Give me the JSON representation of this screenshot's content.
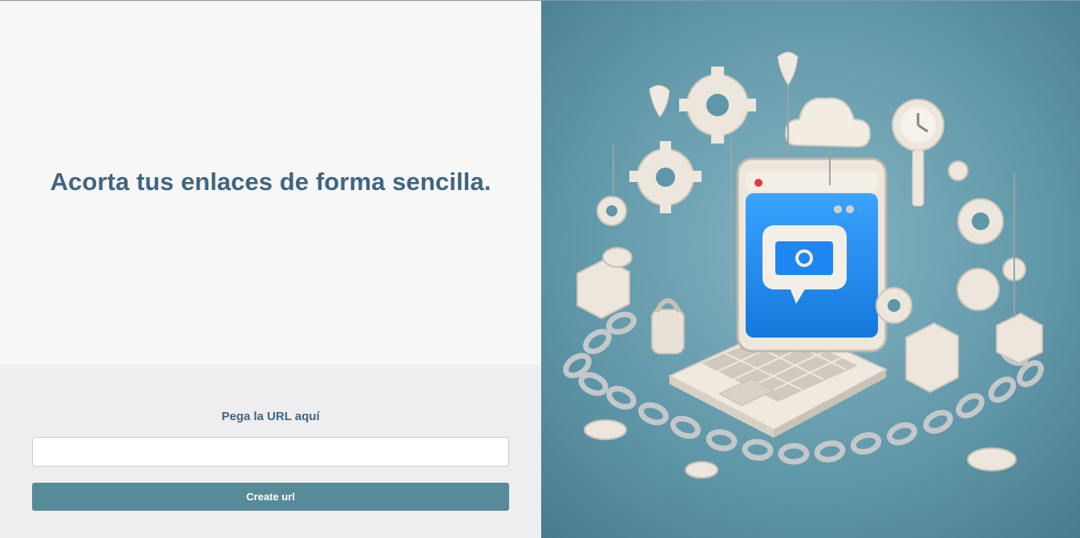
{
  "hero": {
    "headline": "Acorta tus enlaces de forma sencilla."
  },
  "form": {
    "label": "Pega la URL aquí",
    "input_value": "",
    "input_placeholder": "",
    "submit_label": "Create url"
  },
  "illustration": {
    "icon": "link-shortener-illustration",
    "colors": {
      "background": "#5f97a8",
      "screen": "#1e8ef0",
      "device": "#ece6dc",
      "chain": "#b7bcbf"
    }
  }
}
